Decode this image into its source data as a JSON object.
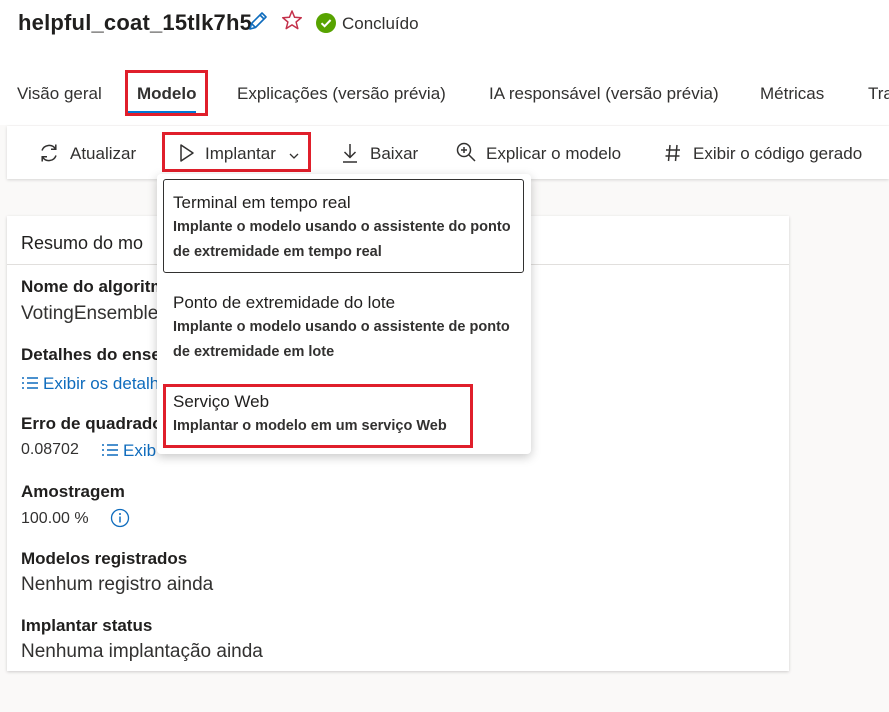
{
  "header": {
    "title": "helpful_coat_15tlk7h5",
    "status": "Concluído"
  },
  "tabs": [
    {
      "label": "Visão geral"
    },
    {
      "label": "Modelo"
    },
    {
      "label": "Explicações (versão prévia)"
    },
    {
      "label": "IA responsável (versão prévia)"
    },
    {
      "label": "Métricas"
    },
    {
      "label": "Tra"
    }
  ],
  "toolbar": {
    "refresh": "Atualizar",
    "deploy": "Implantar",
    "download": "Baixar",
    "explain": "Explicar o modelo",
    "code": "Exibir o código gerado"
  },
  "summary": {
    "title": "Resumo do mo",
    "algorithm_label": "Nome do algoritm",
    "algorithm_value": "VotingEnsemble",
    "ensemble_label": "Detalhes do ense",
    "ensemble_link": "Exibir os detalh",
    "error_label": "Erro de quadrado",
    "error_value": "0.08702",
    "error_link": "Exib",
    "sampling_label": "Amostragem",
    "sampling_value": "100.00 %",
    "registered_label": "Modelos registrados",
    "registered_value": "Nenhum registro ainda",
    "deploy_status_label": "Implantar status",
    "deploy_status_value": "Nenhuma implantação ainda"
  },
  "deploy_menu": [
    {
      "title": "Terminal em tempo real",
      "desc1": "Implante o modelo usando o assistente do ponto",
      "desc2": "de extremidade em tempo real"
    },
    {
      "title": "Ponto de extremidade do lote",
      "desc1": "Implante o modelo usando o assistente de ponto",
      "desc2": "de extremidade em lote"
    },
    {
      "title": "Serviço Web",
      "desc1": "Implantar o modelo em um serviço Web"
    }
  ],
  "colors": {
    "accent": "#0078d4",
    "highlight": "#e01f2b",
    "success": "#57a300",
    "link": "#0f6cbd"
  }
}
